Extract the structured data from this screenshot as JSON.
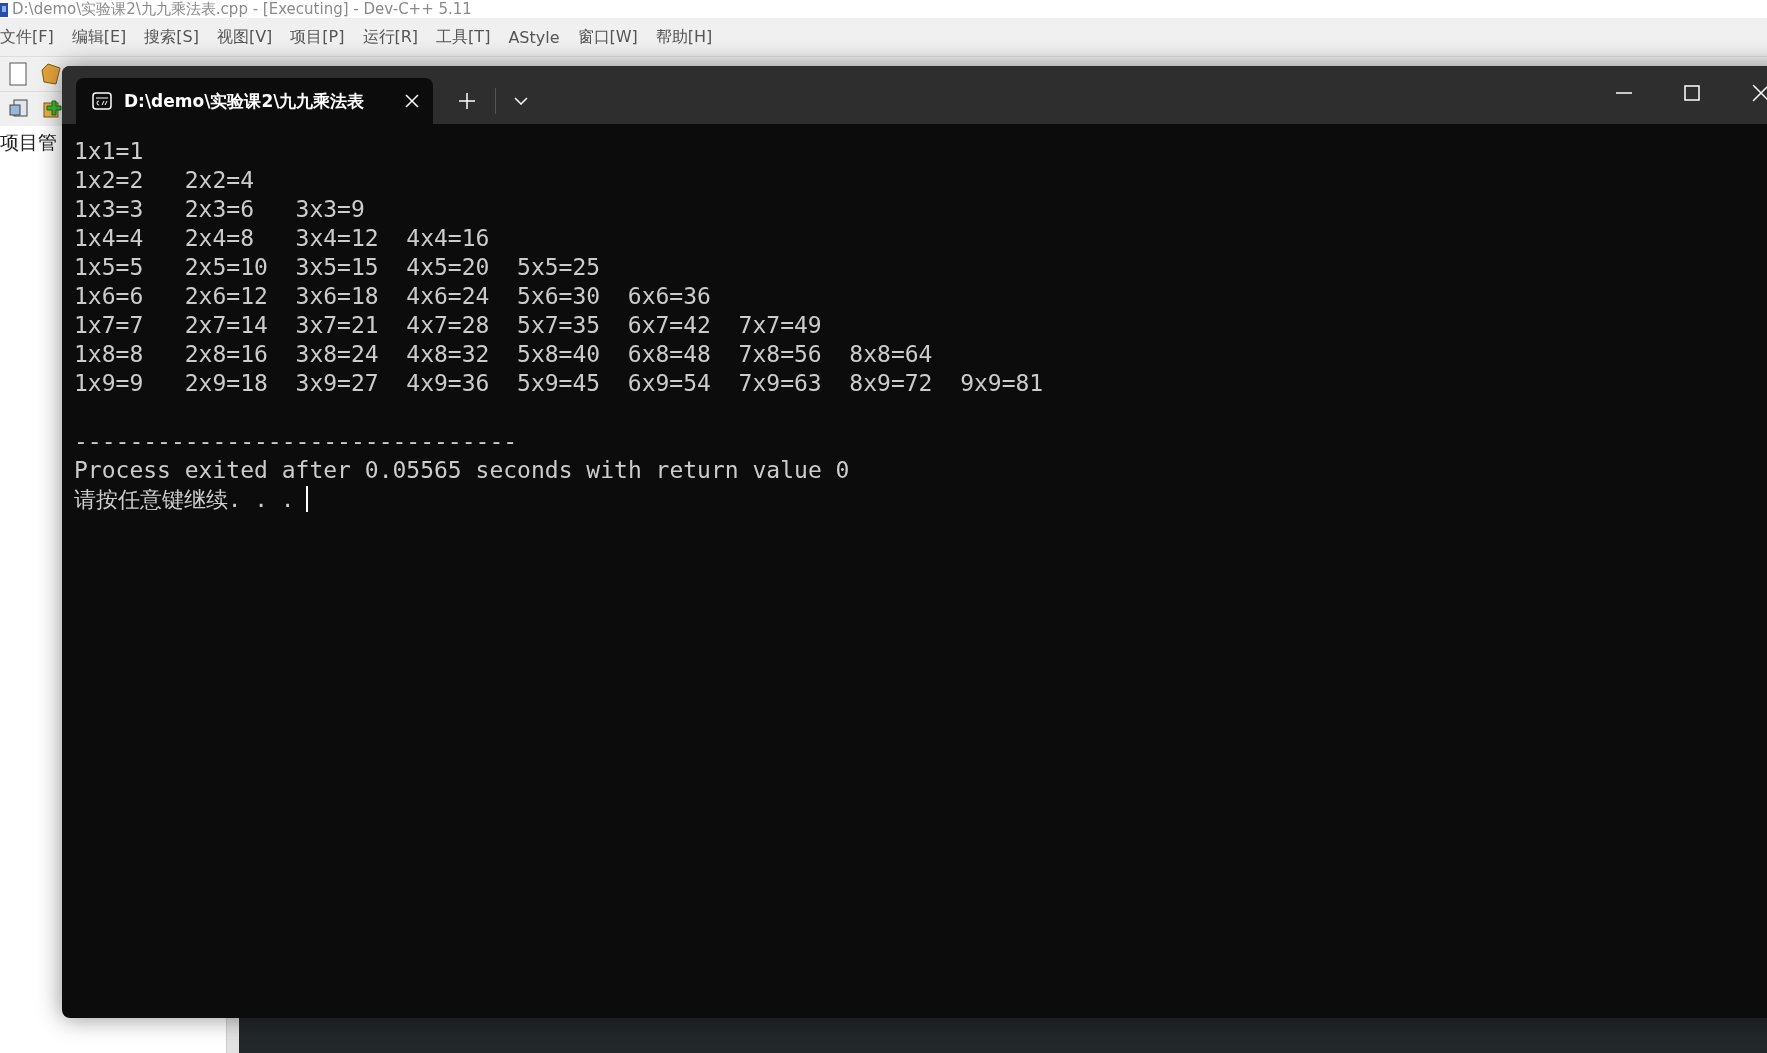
{
  "ide": {
    "title": "D:\\demo\\实验课2\\九九乘法表.cpp - [Executing] - Dev-C++ 5.11",
    "menu": [
      "文件[F]",
      "编辑[E]",
      "搜索[S]",
      "视图[V]",
      "项目[P]",
      "运行[R]",
      "工具[T]",
      "AStyle",
      "窗口[W]",
      "帮助[H]"
    ],
    "side_panel": {
      "title": "项目管"
    }
  },
  "terminal": {
    "tab": {
      "title": "D:\\demo\\实验课2\\九九乘法表",
      "selected": true
    },
    "table": [
      [
        "1x1=1"
      ],
      [
        "1x2=2",
        "2x2=4"
      ],
      [
        "1x3=3",
        "2x3=6",
        "3x3=9"
      ],
      [
        "1x4=4",
        "2x4=8",
        "3x4=12",
        "4x4=16"
      ],
      [
        "1x5=5",
        "2x5=10",
        "3x5=15",
        "4x5=20",
        "5x5=25"
      ],
      [
        "1x6=6",
        "2x6=12",
        "3x6=18",
        "4x6=24",
        "5x6=30",
        "6x6=36"
      ],
      [
        "1x7=7",
        "2x7=14",
        "3x7=21",
        "4x7=28",
        "5x7=35",
        "6x7=42",
        "7x7=49"
      ],
      [
        "1x8=8",
        "2x8=16",
        "3x8=24",
        "4x8=32",
        "5x8=40",
        "6x8=48",
        "7x8=56",
        "8x8=64"
      ],
      [
        "1x9=9",
        "2x9=18",
        "3x9=27",
        "4x9=36",
        "5x9=45",
        "6x9=54",
        "7x9=63",
        "8x9=72",
        "9x9=81"
      ]
    ],
    "separator": "--------------------------------",
    "message": "Process exited after 0.05565 seconds with return value 0",
    "prompt": "请按任意键继续. . ."
  }
}
